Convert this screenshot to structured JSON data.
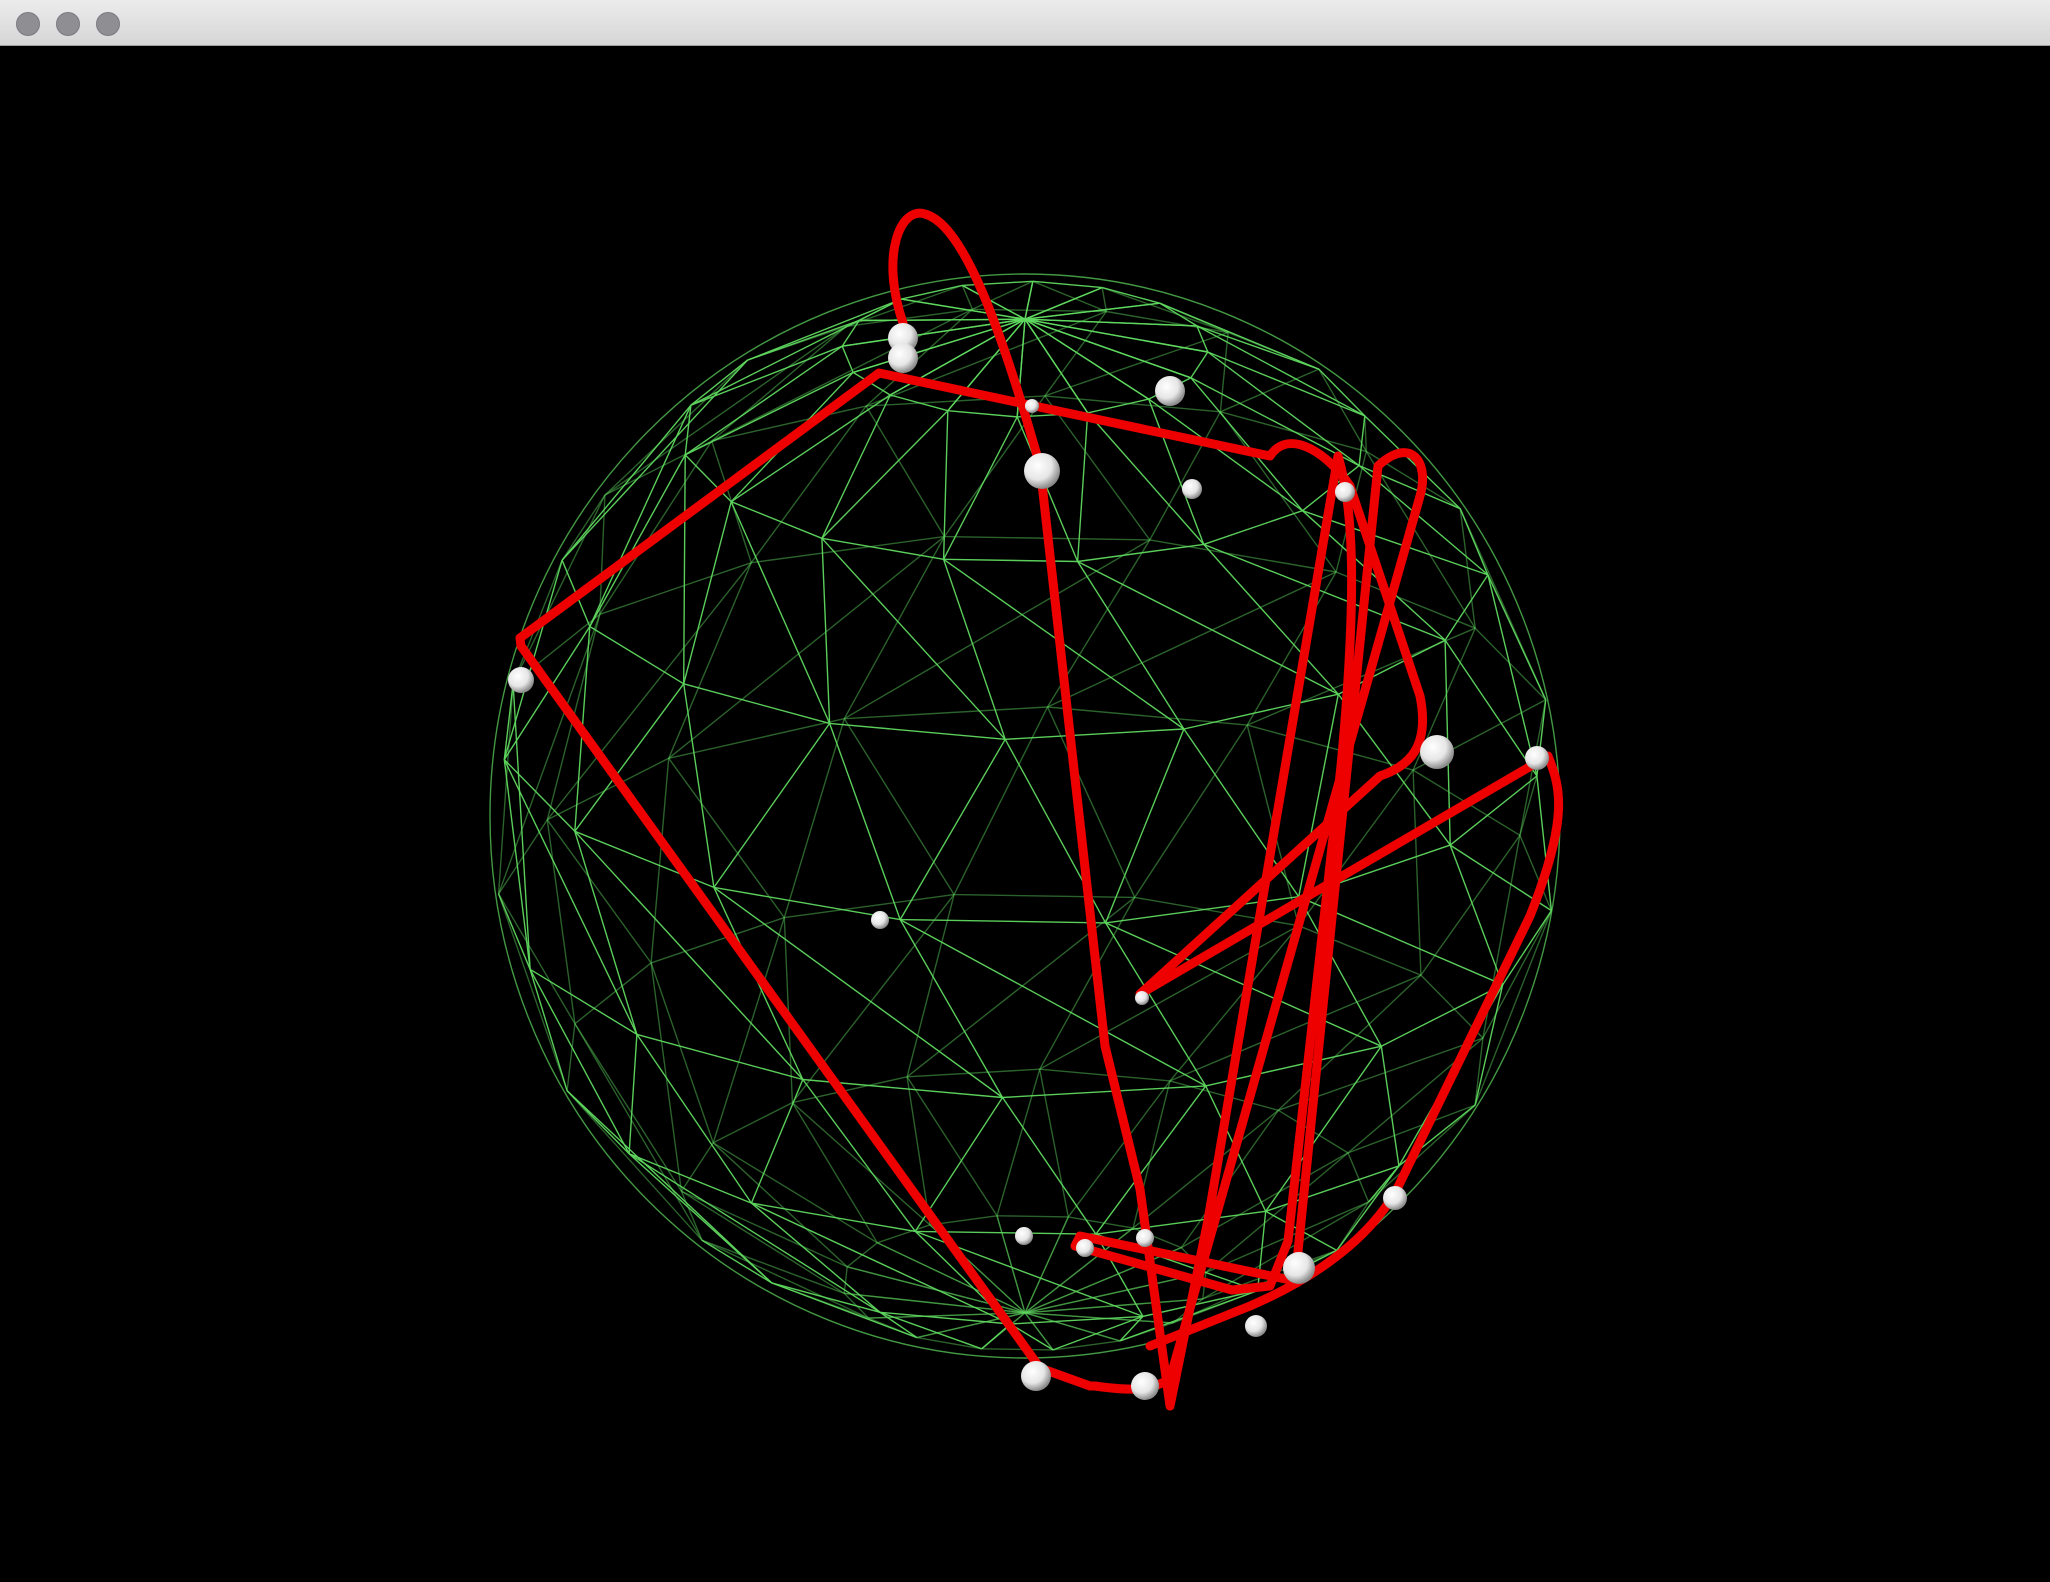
{
  "window": {
    "title": "",
    "controls": [
      "close",
      "minimize",
      "zoom"
    ],
    "control_color": "#8e8e93"
  },
  "scene": {
    "background": "#000000",
    "wireframe_color": "#5fd85f",
    "curve_color": "#ee0000",
    "marker_color": "#ffffff"
  }
}
